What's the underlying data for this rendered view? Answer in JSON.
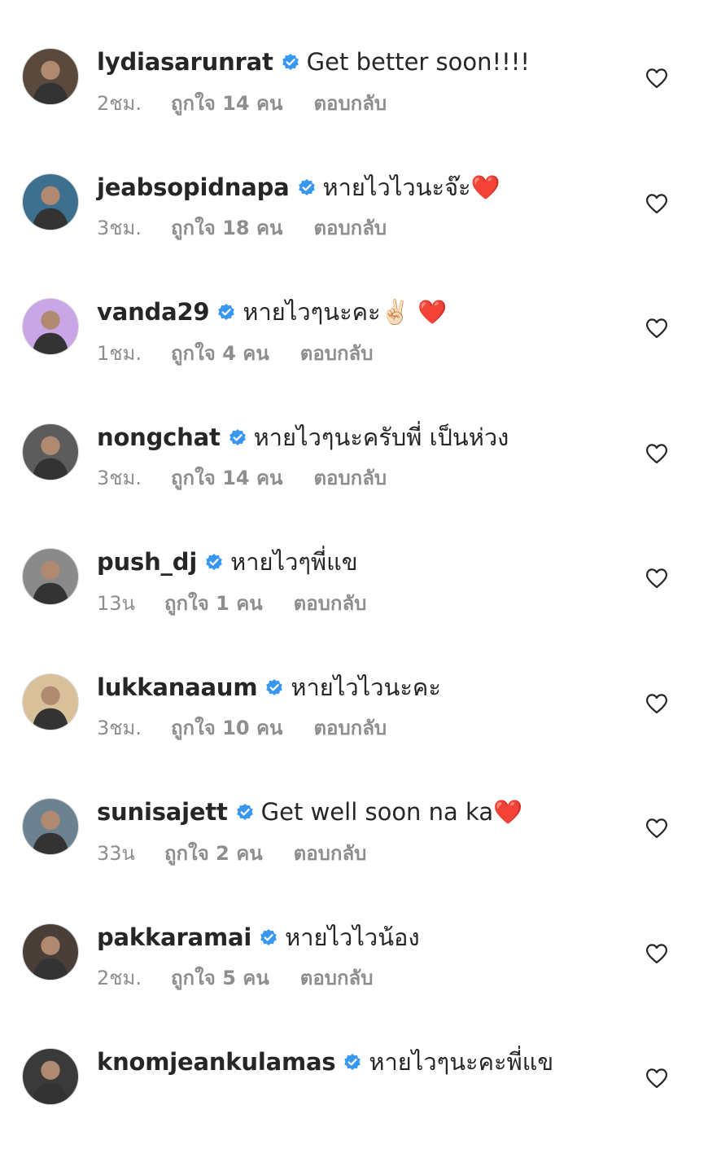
{
  "comments": [
    {
      "username": "lydiasarunrat",
      "text": "Get better soon!!!!",
      "time": "2ชม.",
      "likes": "ถูกใจ 14 คน",
      "reply": "ตอบกลับ",
      "avatar_color": "#5a4a3e"
    },
    {
      "username": "jeabsopidnapa",
      "text": "หายไวไวนะจ๊ะ❤️",
      "time": "3ชม.",
      "likes": "ถูกใจ 18 คน",
      "reply": "ตอบกลับ",
      "avatar_color": "#3d6f8f"
    },
    {
      "username": "vanda29",
      "text": "หายไวๆนะคะ✌🏻 ❤️",
      "time": "1ชม.",
      "likes": "ถูกใจ 4 คน",
      "reply": "ตอบกลับ",
      "avatar_color": "#c9a6e6"
    },
    {
      "username": "nongchat",
      "text": "หายไวๆนะครับพี่ เป็นห่วง",
      "time": "3ชม.",
      "likes": "ถูกใจ 14 คน",
      "reply": "ตอบกลับ",
      "avatar_color": "#5c5c5c"
    },
    {
      "username": "push_dj",
      "text": "หายไวๆพี่แข",
      "time": "13น",
      "likes": "ถูกใจ 1 คน",
      "reply": "ตอบกลับ",
      "avatar_color": "#8a8a8a"
    },
    {
      "username": "lukkanaaum",
      "text": "หายไวไวนะคะ",
      "time": "3ชม.",
      "likes": "ถูกใจ 10 คน",
      "reply": "ตอบกลับ",
      "avatar_color": "#d8c09a"
    },
    {
      "username": "sunisajett",
      "text": "Get well soon na ka❤️",
      "time": "33น",
      "likes": "ถูกใจ 2 คน",
      "reply": "ตอบกลับ",
      "avatar_color": "#6d8290"
    },
    {
      "username": "pakkaramai",
      "text": "หายไวไวน้อง",
      "time": "2ชม.",
      "likes": "ถูกใจ 5 คน",
      "reply": "ตอบกลับ",
      "avatar_color": "#4a3f38"
    },
    {
      "username": "knomjeankulamas",
      "text": "หายไวๆนะคะพี่แข",
      "time": "",
      "likes": "",
      "reply": "",
      "avatar_color": "#3a3a3a"
    }
  ],
  "colors": {
    "verified": "#3897f0",
    "meta": "#8e8e8e",
    "text": "#262626",
    "heart_outline": "#262626"
  },
  "icons": {
    "verified": "verified-badge-icon",
    "like": "heart-outline-icon"
  }
}
